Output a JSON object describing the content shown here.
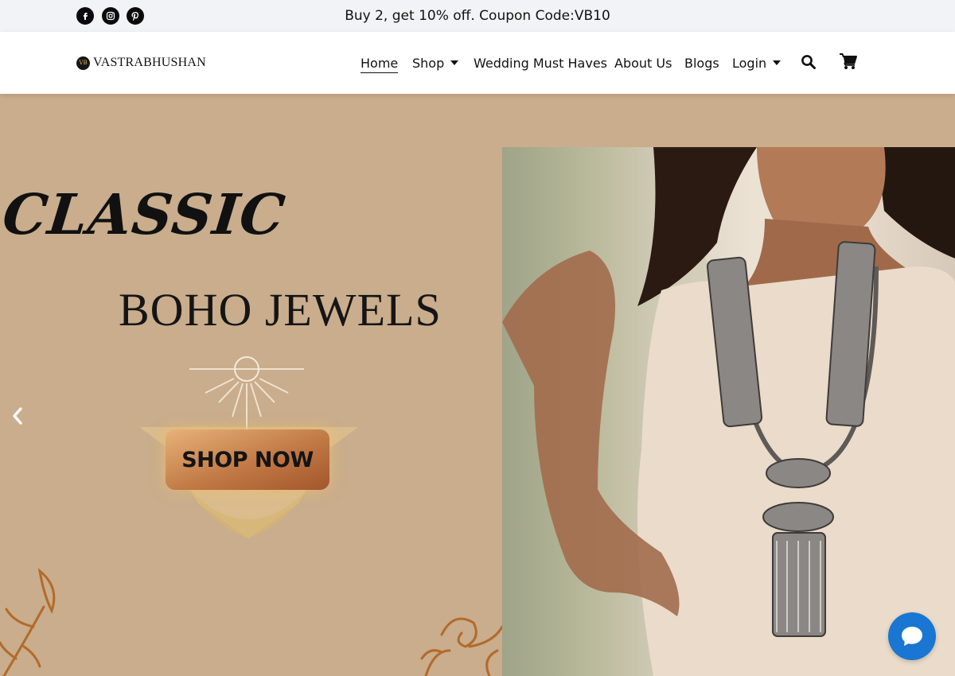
{
  "topbar": {
    "social": [
      {
        "icon": "facebook-icon"
      },
      {
        "icon": "instagram-icon"
      },
      {
        "icon": "pinterest-icon"
      }
    ],
    "promo_text": "Buy 2, get 10% off. Coupon Code:VB10"
  },
  "header": {
    "logo_mark": "VB",
    "logo_text": "VASTRABHUSHAN",
    "nav": [
      {
        "label": "Home",
        "active": true
      },
      {
        "label": "Shop",
        "dropdown": true
      },
      {
        "label": "Wedding Must Haves"
      },
      {
        "label": "About Us"
      },
      {
        "label": "Blogs"
      },
      {
        "label": "Login",
        "dropdown": true
      }
    ],
    "icons": [
      "search-icon",
      "cart-icon"
    ]
  },
  "hero": {
    "headline_1": "CLASSIC",
    "headline_2": "BOHO JEWELS",
    "cta_label": "SHOP NOW",
    "prev_icon": "chevron-left-icon"
  },
  "chat": {
    "icon": "chat-bubble-icon"
  },
  "colors": {
    "topbar_bg": "#f1f3f7",
    "hero_bg": "#c9ad8c",
    "chat_accent": "#1976d2",
    "cta_copper": "#c17945"
  }
}
